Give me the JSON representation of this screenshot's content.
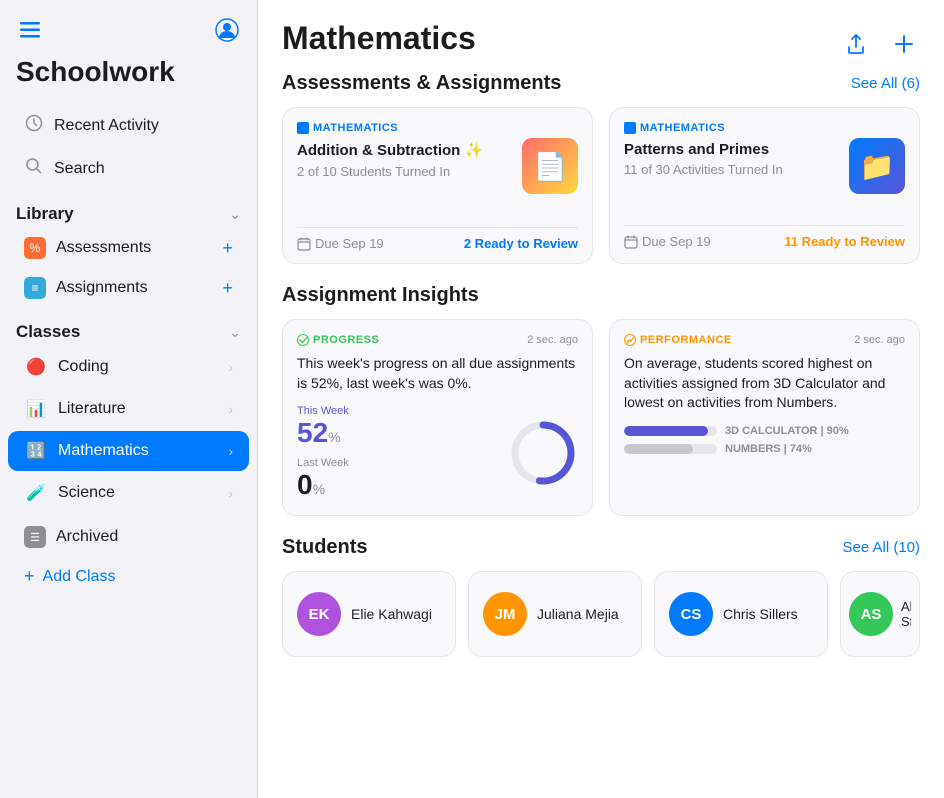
{
  "app": {
    "title": "Schoolwork"
  },
  "sidebar": {
    "recent_activity_label": "Recent Activity",
    "search_label": "Search",
    "library_label": "Library",
    "assessments_label": "Assessments",
    "assignments_label": "Assignments",
    "classes_label": "Classes",
    "classes": [
      {
        "name": "Coding",
        "icon": "🔴",
        "color": "#ff3b30",
        "active": false
      },
      {
        "name": "Literature",
        "icon": "📊",
        "color": "#ff9500",
        "active": false
      },
      {
        "name": "Mathematics",
        "icon": "🔢",
        "color": "#007aff",
        "active": true
      },
      {
        "name": "Science",
        "icon": "🧪",
        "color": "#34c759",
        "active": false
      }
    ],
    "archived_label": "Archived",
    "add_class_label": "Add Class"
  },
  "main": {
    "title": "Mathematics",
    "assessments_section": {
      "title": "Assessments & Assignments",
      "see_all": "See All (6)",
      "cards": [
        {
          "tag": "MATHEMATICS",
          "title": "Addition & Subtraction ✨",
          "subtitle": "2 of 10 Students Turned In",
          "due": "Due Sep 19",
          "review": "2 Ready to Review",
          "review_color": "blue"
        },
        {
          "tag": "MATHEMATICS",
          "title": "Patterns and Primes",
          "subtitle": "11 of 30 Activities Turned In",
          "due": "Due Sep 19",
          "review": "11 Ready to Review",
          "review_color": "orange"
        }
      ]
    },
    "insights_section": {
      "title": "Assignment Insights",
      "progress_card": {
        "tag": "PROGRESS",
        "time": "2 sec. ago",
        "text": "This week's progress on all due assignments is 52%, last week's was 0%.",
        "this_week_label": "This Week",
        "last_week_label": "Last Week",
        "this_week_value": "52",
        "last_week_value": "0",
        "unit": "%",
        "percent": 52
      },
      "performance_card": {
        "tag": "PERFORMANCE",
        "time": "2 sec. ago",
        "text": "On average, students scored highest on activities assigned from 3D Calculator and lowest on activities from Numbers.",
        "bars": [
          {
            "label": "3D CALCULATOR | 90%",
            "value": 90,
            "color": "#5856d6"
          },
          {
            "label": "NUMBERS | 74%",
            "value": 74,
            "color": "#c7c7cc"
          }
        ]
      }
    },
    "students_section": {
      "title": "Students",
      "see_all": "See All (10)",
      "students": [
        {
          "initials": "EK",
          "name": "Elie Kahwagi",
          "color": "#af52de"
        },
        {
          "initials": "JM",
          "name": "Juliana Mejia",
          "color": "#ff9500"
        },
        {
          "initials": "CS",
          "name": "Chris Sillers",
          "color": "#007aff"
        },
        {
          "initials": "AS",
          "name": "Abbi Stein",
          "color": "#34c759",
          "partial": true
        }
      ]
    }
  }
}
